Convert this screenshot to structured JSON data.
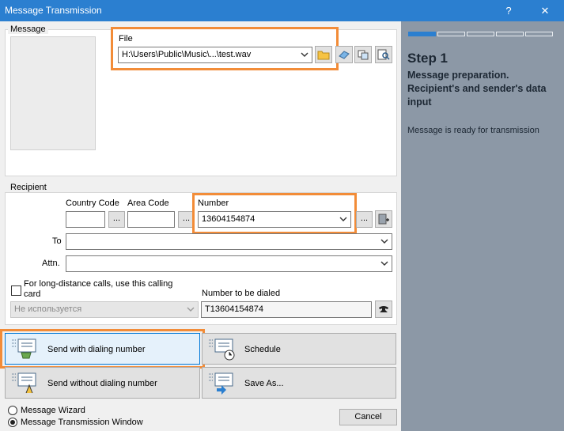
{
  "window": {
    "title": "Message Transmission",
    "help_glyph": "?",
    "close_glyph": "✕"
  },
  "message": {
    "group_label": "Message",
    "file_label": "File",
    "file_value": "H:\\Users\\Public\\Music\\...\\test.wav"
  },
  "recipient": {
    "group_label": "Recipient",
    "country_code_label": "Country Code",
    "area_code_label": "Area Code",
    "number_label": "Number",
    "number_value": "13604154874",
    "to_label": "To",
    "attn_label": "Attn.",
    "calling_card_label": "For long-distance calls, use this calling card",
    "calling_card_value": "Не используется",
    "dialed_label": "Number to be dialed",
    "dialed_value": "T13604154874",
    "ellipsis": "..."
  },
  "actions": {
    "send_with": "Send with dialing number",
    "schedule": "Schedule",
    "send_without": "Send without dialing number",
    "save_as": "Save As..."
  },
  "footer": {
    "wizard_label": "Message Wizard",
    "window_label": "Message Transmission Window",
    "cancel": "Cancel"
  },
  "wizard": {
    "step_title": "Step 1",
    "step_desc": "Message preparation. Recipient's and sender's data input",
    "status": "Message is ready for transmission",
    "progress_segments": 5,
    "progress_active": 1
  },
  "colors": {
    "title_bar": "#2b7fd0",
    "side_panel": "#8c98a6",
    "highlight": "#f28c38",
    "progress_active": "#2b7fd0"
  }
}
